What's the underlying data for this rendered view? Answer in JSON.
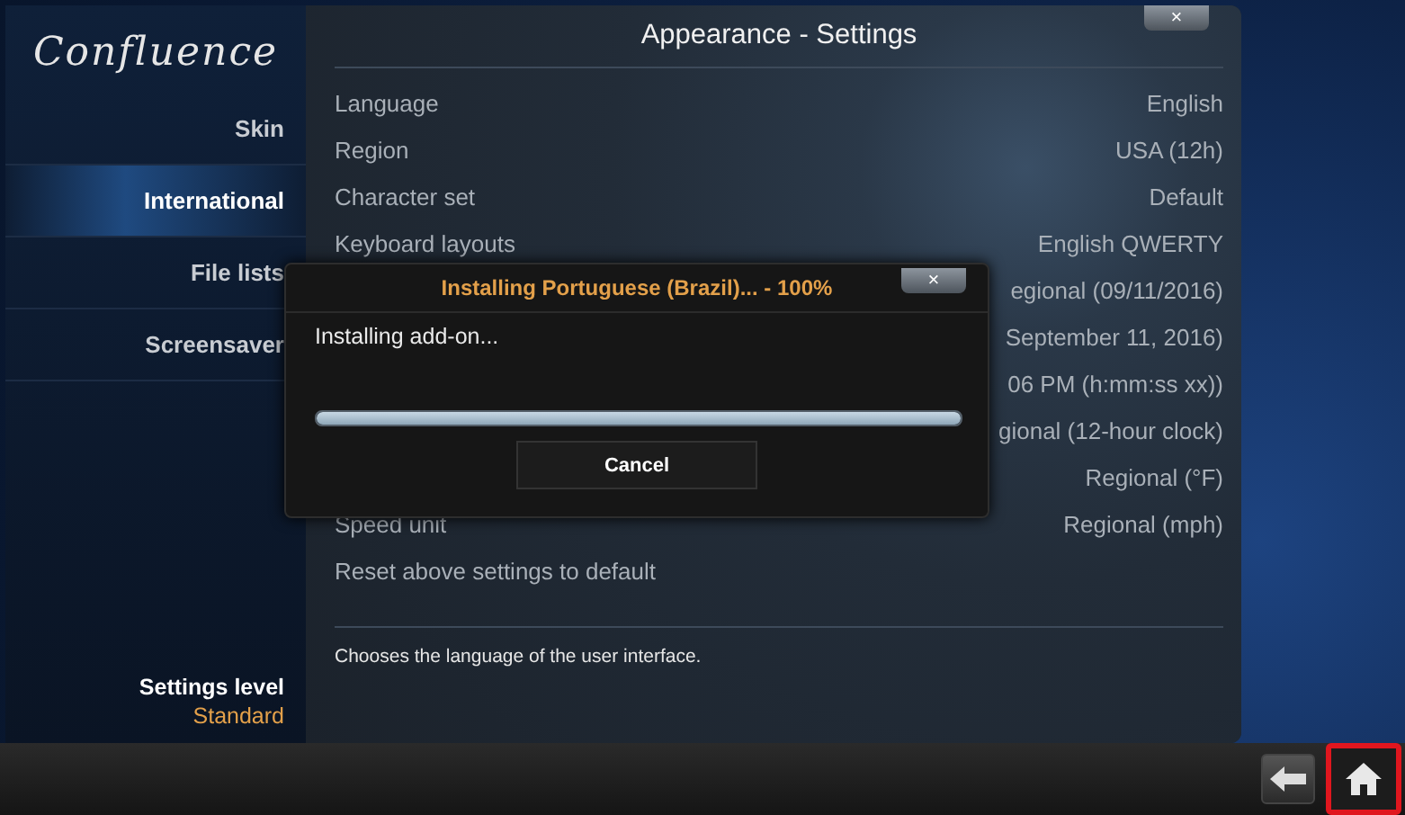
{
  "logo": "Confluence",
  "sidebar": {
    "items": [
      {
        "label": "Skin",
        "selected": false
      },
      {
        "label": "International",
        "selected": true
      },
      {
        "label": "File lists",
        "selected": false
      },
      {
        "label": "Screensaver",
        "selected": false
      }
    ],
    "settings_level": {
      "label": "Settings level",
      "value": "Standard"
    }
  },
  "window": {
    "title": "Appearance - Settings",
    "close": "×"
  },
  "settings": [
    {
      "label": "Language",
      "value": "English"
    },
    {
      "label": "Region",
      "value": "USA (12h)"
    },
    {
      "label": "Character set",
      "value": "Default"
    },
    {
      "label": "Keyboard layouts",
      "value": "English QWERTY"
    },
    {
      "value": "egional (09/11/2016)"
    },
    {
      "value": "September 11, 2016)"
    },
    {
      "value": "06 PM (h:mm:ss xx))"
    },
    {
      "value": "gional (12-hour clock)"
    },
    {
      "value": "Regional (°F)"
    },
    {
      "label": "Speed unit",
      "value": "Regional (mph)"
    },
    {
      "label": "Reset above settings to default"
    }
  ],
  "description": "Chooses the language of the user interface.",
  "dialog": {
    "title": "Installing Portuguese (Brazil)... - 100%",
    "close": "×",
    "message": "Installing add-on...",
    "progress": {
      "level": 1.0
    },
    "button": "Cancel"
  },
  "bottom_bar": {
    "buttons": [
      {
        "kind": "back",
        "highlighted": false
      },
      {
        "kind": "home",
        "highlighted": true
      }
    ]
  }
}
